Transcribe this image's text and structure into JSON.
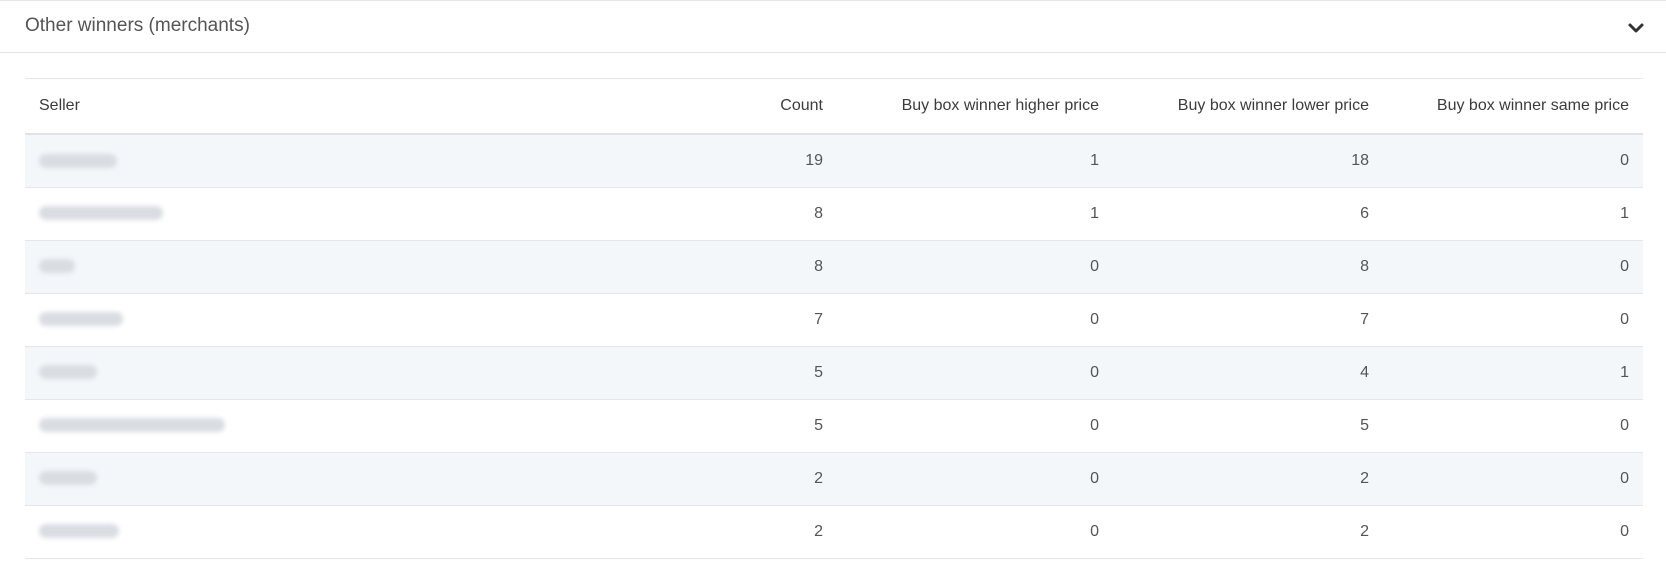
{
  "panel": {
    "title": "Other winners (merchants)",
    "toggle_icon": "chevron-down-icon"
  },
  "table": {
    "columns": [
      "Seller",
      "Count",
      "Buy box winner higher price",
      "Buy box winner lower price",
      "Buy box winner same price"
    ],
    "rows": [
      {
        "seller": "",
        "count": "19",
        "higher": "1",
        "lower": "18",
        "same": "0"
      },
      {
        "seller": "",
        "count": "8",
        "higher": "1",
        "lower": "6",
        "same": "1"
      },
      {
        "seller": "",
        "count": "8",
        "higher": "0",
        "lower": "8",
        "same": "0"
      },
      {
        "seller": "",
        "count": "7",
        "higher": "0",
        "lower": "7",
        "same": "0"
      },
      {
        "seller": "",
        "count": "5",
        "higher": "0",
        "lower": "4",
        "same": "1"
      },
      {
        "seller": "",
        "count": "5",
        "higher": "0",
        "lower": "5",
        "same": "0"
      },
      {
        "seller": "",
        "count": "2",
        "higher": "0",
        "lower": "2",
        "same": "0"
      },
      {
        "seller": "",
        "count": "2",
        "higher": "0",
        "lower": "2",
        "same": "0"
      }
    ]
  }
}
